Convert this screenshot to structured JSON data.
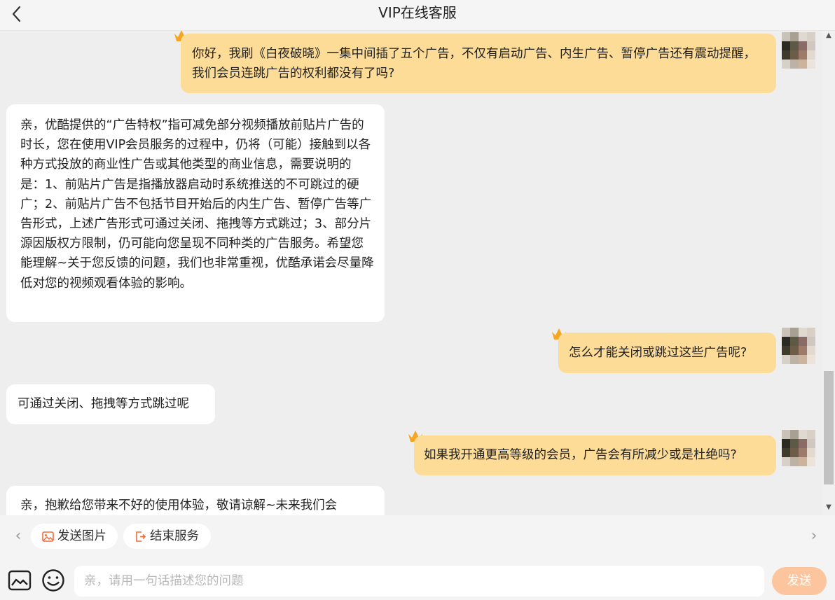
{
  "header": {
    "title": "VIP在线客服"
  },
  "messages": [
    {
      "role": "user",
      "text": "你好，我刷《白夜破晓》一集中间插了五个广告，不仅有启动广告、内生广告、暂停广告还有震动提醒，我们会员连跳广告的权利都没有了吗?"
    },
    {
      "role": "agent",
      "text": "亲，优酷提供的“广告特权”指可减免部分视频播放前贴片广告的时长，您在使用VIP会员服务的过程中，仍将（可能）接触到以各种方式投放的商业性广告或其他类型的商业信息，需要说明的是：1、前贴片广告是指播放器启动时系统推送的不可跳过的硬广；2、前贴片广告不包括节目开始后的内生广告、暂停广告等广告形式，上述广告形式可通过关闭、拖拽等方式跳过；3、部分片源因版权方限制，仍可能向您呈现不同种类的广告服务。希望您能理解~关于您反馈的问题，我们也非常重视，优酷承诺会尽量降低对您的视频观看体验的影响。"
    },
    {
      "role": "user",
      "text": "怎么才能关闭或跳过这些广告呢?"
    },
    {
      "role": "agent",
      "text": "可通过关闭、拖拽等方式跳过呢"
    },
    {
      "role": "user",
      "text": "如果我开通更高等级的会员，广告会有所减少或是杜绝吗?"
    },
    {
      "role": "agent",
      "text": "亲，抱歉给您带来不好的使用体验，敬请谅解~未来我们会"
    }
  ],
  "quick_actions": [
    {
      "label": "发送图片",
      "icon": "image-icon"
    },
    {
      "label": "结束服务",
      "icon": "exit-icon"
    }
  ],
  "input": {
    "placeholder": "亲，请用一句话描述您的问题",
    "value": ""
  },
  "send_label": "发送",
  "colors": {
    "user_bubble": "#fddc98",
    "agent_bubble": "#ffffff",
    "background": "#eeeeee",
    "send_button": "#fcc59e",
    "crown": "#f5a623",
    "accent_icon": "#f26b3a"
  }
}
